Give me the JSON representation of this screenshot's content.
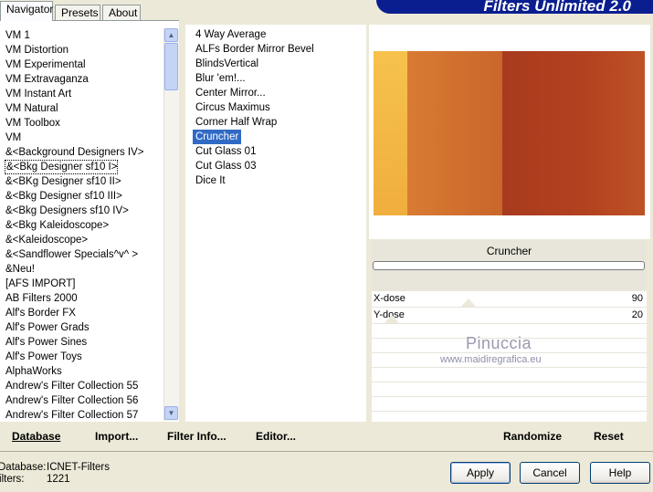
{
  "tabs": [
    "Navigator",
    "Presets",
    "About"
  ],
  "banner_title": "Filters Unlimited 2.0",
  "categories": [
    "VM 1",
    "VM Distortion",
    "VM Experimental",
    "VM Extravaganza",
    "VM Instant Art",
    "VM Natural",
    "VM Toolbox",
    "VM",
    "&<Background Designers IV>",
    "&<Bkg Designer sf10 I>",
    "&<BKg Designer sf10 II>",
    "&<Bkg Designer sf10 III>",
    "&<Bkg Designers sf10 IV>",
    "&<Bkg Kaleidoscope>",
    "&<Kaleidoscope>",
    "&<Sandflower Specials^v^ >",
    "&Neu!",
    "[AFS IMPORT]",
    "AB Filters 2000",
    "Alf's Border FX",
    "Alf's Power Grads",
    "Alf's Power Sines",
    "Alf's Power Toys",
    "AlphaWorks",
    "Andrew's Filter Collection 55",
    "Andrew's Filter Collection 56",
    "Andrew's Filter Collection 57"
  ],
  "selected_category_index": 9,
  "filters": [
    "4 Way Average",
    "ALFs Border Mirror Bevel",
    "BlindsVertical",
    "Blur 'em!...",
    "Center Mirror...",
    "Circus Maximus",
    "Corner Half Wrap",
    "Cruncher",
    "Cut Glass 01",
    "Cut Glass 03",
    "Dice It"
  ],
  "selected_filter_index": 7,
  "filter_name": "Cruncher",
  "params": [
    {
      "label": "X-dose",
      "value": "90"
    },
    {
      "label": "Y-dose",
      "value": "20"
    }
  ],
  "watermark": {
    "line1": "Pinuccia",
    "line2": "www.maidiregrafica.eu"
  },
  "bottom_bar": {
    "database": "Database",
    "import": "Import...",
    "filter_info": "Filter Info...",
    "editor": "Editor...",
    "randomize": "Randomize",
    "reset": "Reset"
  },
  "status": {
    "database_label": "Database:",
    "database_value": "ICNET-Filters",
    "filters_label": "Filters:",
    "filters_value": "1221"
  },
  "dialog_buttons": {
    "apply": "Apply",
    "cancel": "Cancel",
    "help": "Help"
  },
  "colors": {
    "selection": "#316AC5",
    "banner": "#0A1E8F",
    "face": "#ECE9D8"
  }
}
